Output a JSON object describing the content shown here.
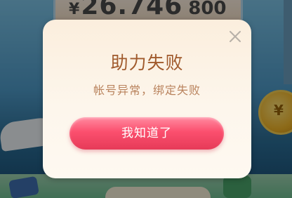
{
  "background": {
    "currency_symbol": "¥",
    "amount_main": "26.746",
    "amount_trailing": "800"
  },
  "dialog": {
    "title": "助力失败",
    "message": "帐号异常，绑定失败",
    "button_label": "我知道了",
    "close_icon": "close-icon"
  },
  "colors": {
    "title": "#a05a2c",
    "message": "#b9835d",
    "button": "#fb4f6e",
    "dialog_bg": "#fdf6ec"
  }
}
